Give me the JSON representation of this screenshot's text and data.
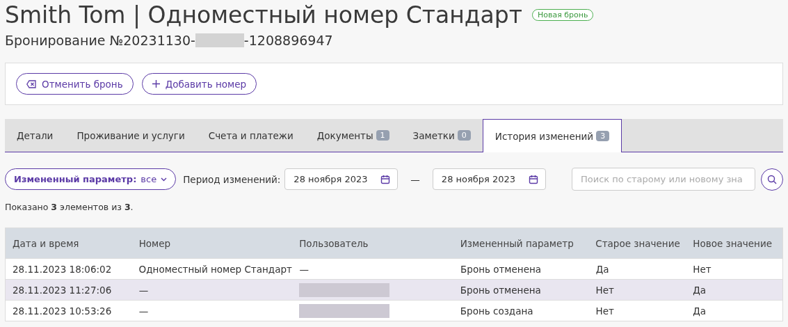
{
  "header": {
    "title": "Smith Tom | Одноместный номер Стандарт",
    "status_badge": "Новая бронь",
    "booking_prefix": "Бронирование №20231130-",
    "booking_redacted": true,
    "booking_suffix": "-1208896947"
  },
  "actions": [
    {
      "kind": "cancel",
      "label": "Отменить бронь"
    },
    {
      "kind": "add",
      "label": "Добавить номер"
    }
  ],
  "tabs": [
    {
      "label": "Детали",
      "selected": false
    },
    {
      "label": "Проживание и услуги",
      "selected": false
    },
    {
      "label": "Счета и платежи",
      "selected": false
    },
    {
      "label": "Документы",
      "count": "1",
      "selected": false
    },
    {
      "label": "Заметки",
      "count": "0",
      "selected": false
    },
    {
      "label": "История изменений",
      "count": "3",
      "selected": true
    }
  ],
  "filters": {
    "parameter_label": "Измененный параметр:",
    "parameter_value": "все",
    "period_label": "Период изменений:",
    "date_from": "28 ноября 2023",
    "separator": "—",
    "date_to": "28 ноября 2023",
    "search_placeholder": "Поиск по старому или новому зна"
  },
  "summary": "Показано **3** элементов из **3**.",
  "table": {
    "columns": [
      "Дата и время",
      "Номер",
      "Пользователь",
      "Измененный параметр",
      "Старое значение",
      "Новое значение"
    ],
    "rows": [
      {
        "selected": false,
        "datetime": "28.11.2023 18:06:02",
        "room": "Одноместный номер Стандарт",
        "user": "—",
        "user_redacted": false,
        "parameter": "Бронь отменена",
        "old_value": "Да",
        "new_value": "Нет"
      },
      {
        "selected": true,
        "datetime": "28.11.2023 11:27:06",
        "room": "—",
        "user_redacted": true,
        "parameter": "Бронь отменена",
        "old_value": "Нет",
        "new_value": "Да"
      },
      {
        "selected": false,
        "datetime": "28.11.2023 10:53:26",
        "room": "—",
        "user_redacted": true,
        "parameter": "Бронь создана",
        "old_value": "Нет",
        "new_value": "Да"
      }
    ]
  }
}
